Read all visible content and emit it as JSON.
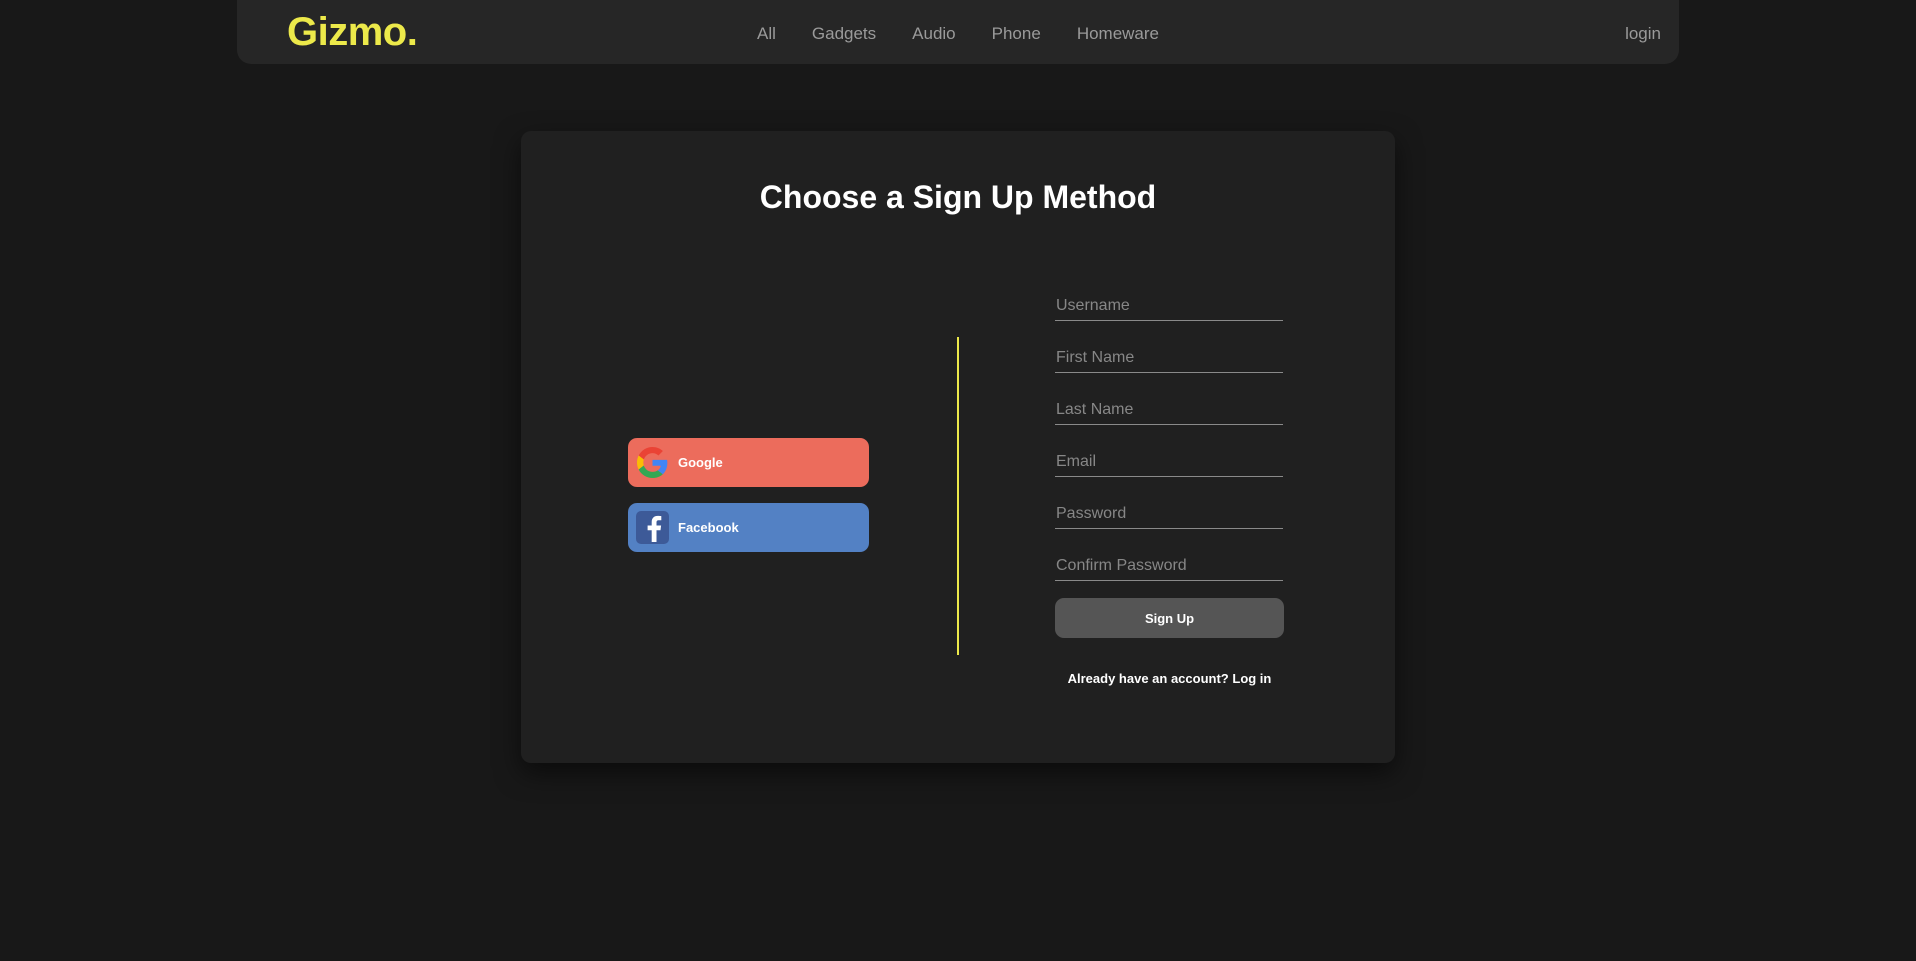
{
  "navbar": {
    "logo": "Gizmo.",
    "links": [
      "All",
      "Gadgets",
      "Audio",
      "Phone",
      "Homeware"
    ],
    "login_label": "login"
  },
  "signup": {
    "title": "Choose a Sign Up Method",
    "social": {
      "google_label": "Google",
      "facebook_label": "Facebook"
    },
    "fields": {
      "username_placeholder": "Username",
      "first_name_placeholder": "First Name",
      "last_name_placeholder": "Last Name",
      "email_placeholder": "Email",
      "password_placeholder": "Password",
      "confirm_password_placeholder": "Confirm Password"
    },
    "submit_label": "Sign Up",
    "login_prompt_text": "Already have an account?",
    "login_link_label": "Log in"
  },
  "colors": {
    "accent": "#ece94a",
    "google": "#ec6c5c",
    "facebook": "#5381c4",
    "background": "#181818",
    "card": "#202020"
  },
  "icons": {
    "google": "google-icon",
    "facebook": "facebook-icon"
  }
}
